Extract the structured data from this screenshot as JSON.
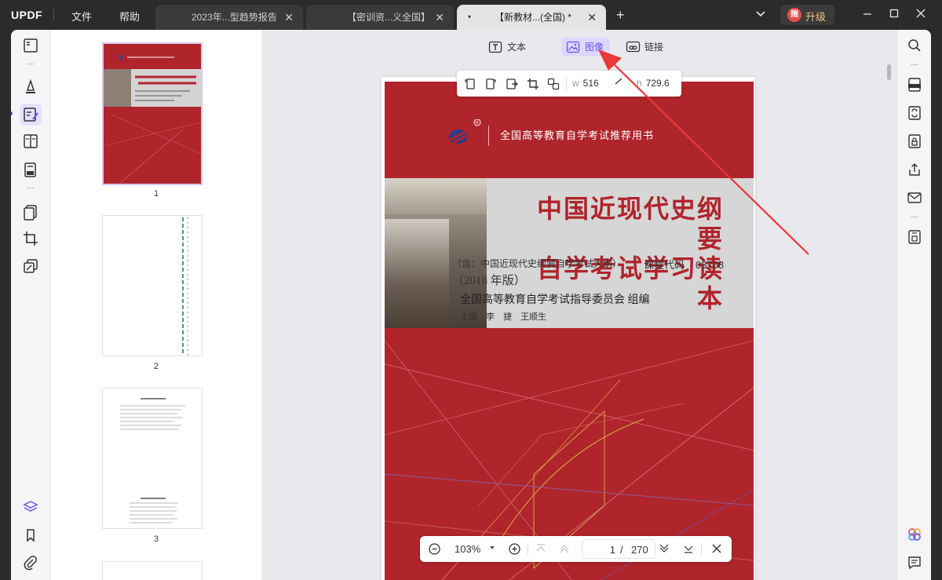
{
  "app": {
    "logo_main": "UPDF",
    "logo_accent": ""
  },
  "menu": {
    "file": "文件",
    "help": "帮助"
  },
  "tabs": [
    {
      "label": "2023年...型趋势报告"
    },
    {
      "label": "【密训资...义全国】"
    },
    {
      "label": "【新教材...(全国) *"
    }
  ],
  "header": {
    "upgrade_label": "升级",
    "avatar_text": "揣"
  },
  "edit_toolbar": {
    "text_label": "文本",
    "image_label": "图像",
    "link_label": "链接"
  },
  "image_props": {
    "w_key": "w",
    "w_value": "516",
    "h_key": "h",
    "h_value": "729.6"
  },
  "thumbnails": {
    "page1": "1",
    "page2": "2",
    "page3": "3"
  },
  "cover": {
    "series": "全国高等教育自学考试推荐用书",
    "title_line1": "中国近现代史纲要",
    "title_line2": "自学考试学习读本",
    "includes": "（含：中国近现代史纲要自学考试大纲）",
    "course_code_label": "课程代码",
    "course_code": "03708",
    "edition": "（2018 年版）",
    "committee": "全国高等教育自学考试指导委员会  组编",
    "editors": "主编 李 捷 王顺生"
  },
  "nav": {
    "zoom": "103%",
    "current_page": "1",
    "separator": "/",
    "total_pages": "270"
  },
  "colors": {
    "accent": "#6c52e8",
    "cover_red": "#b0242b",
    "annotation_arrow": "#e8383a"
  }
}
